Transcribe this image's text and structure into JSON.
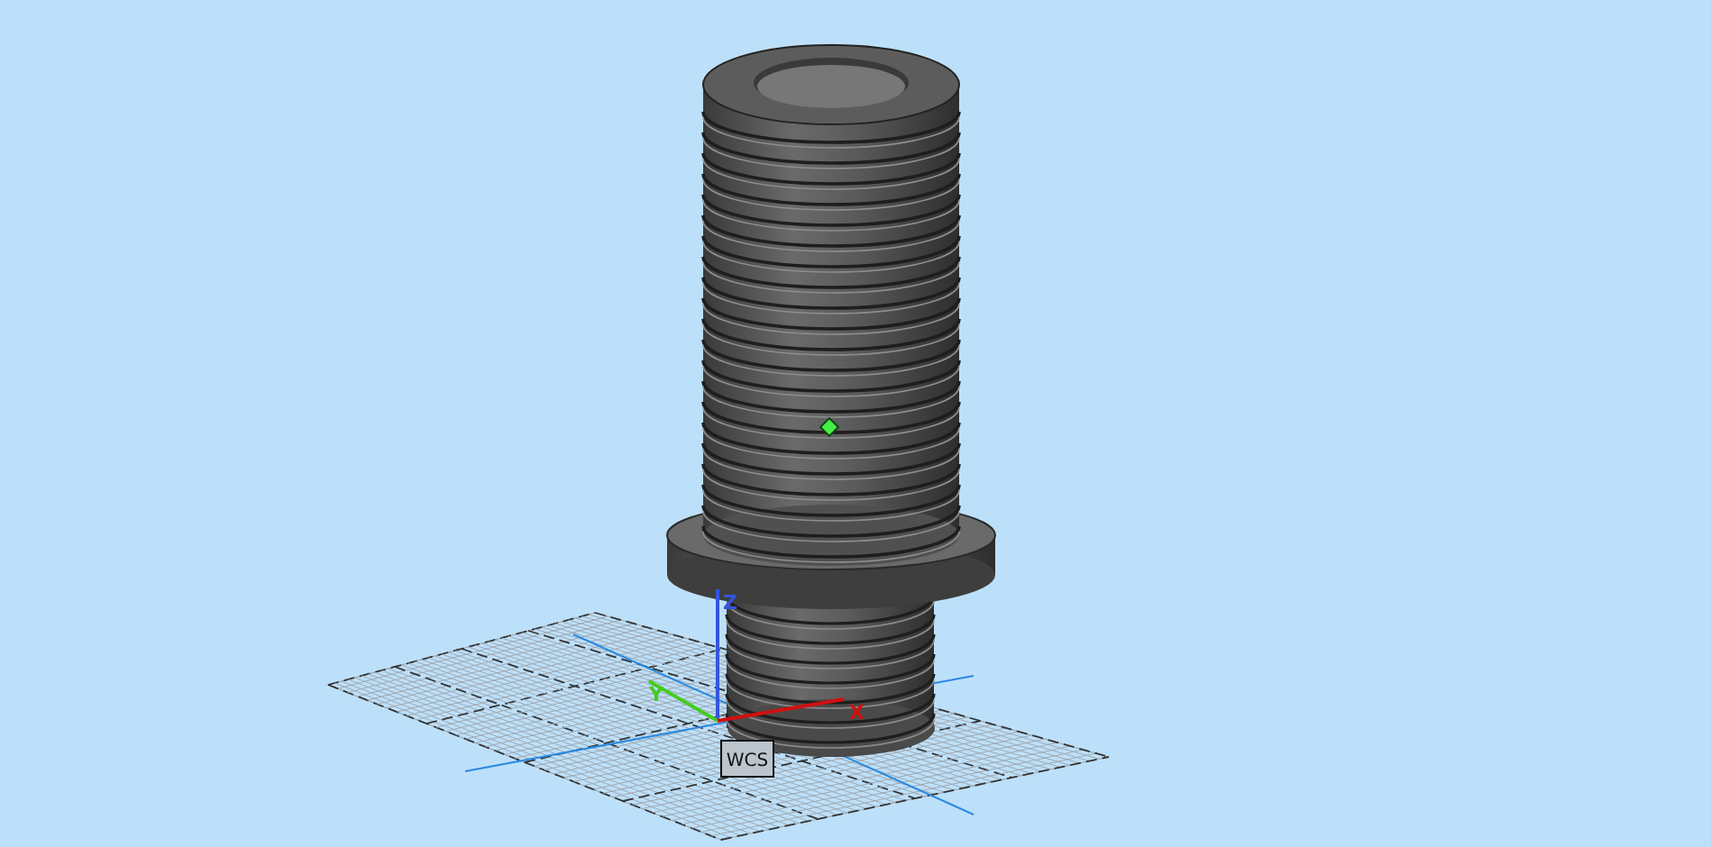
{
  "viewport": {
    "axes": [
      {
        "kind": "z",
        "label": "Z",
        "color": "#3355dd"
      },
      {
        "kind": "y",
        "label": "Y",
        "color": "#44cc22"
      },
      {
        "kind": "x",
        "label": "X",
        "color": "#d01010"
      }
    ],
    "coordinate_label": "WCS"
  }
}
